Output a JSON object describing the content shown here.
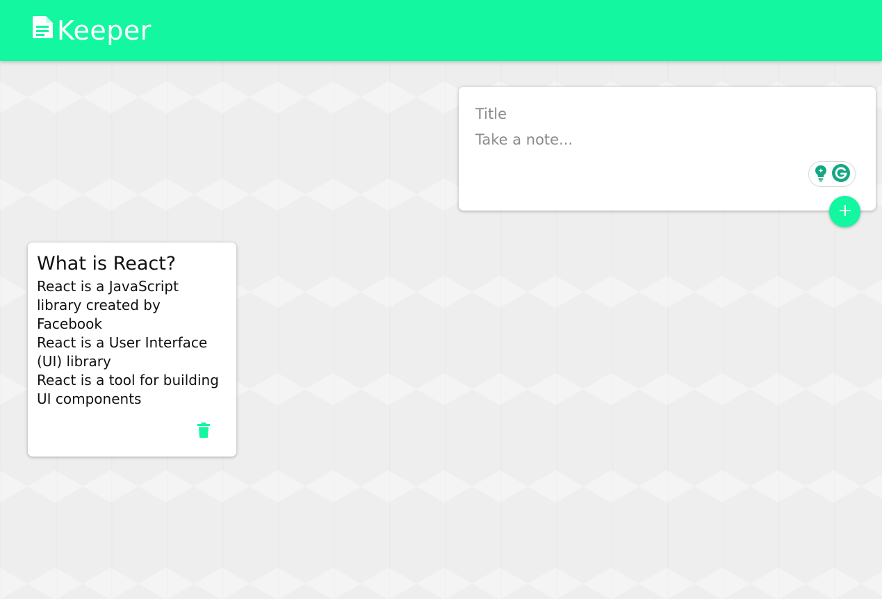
{
  "header": {
    "app_name": "Keeper",
    "logo_icon": "note-document-icon",
    "background_color": "#13f7a0"
  },
  "create_note": {
    "title_placeholder": "Title",
    "content_placeholder": "Take a note...",
    "add_icon": "plus-icon",
    "extension_icons": [
      "lightbulb-icon",
      "grammarly-icon"
    ]
  },
  "notes": [
    {
      "title": "What is React?",
      "content": "React is a JavaScript library created by Facebook\nReact is a User Interface (UI) library\nReact is a tool for building UI components",
      "delete_icon": "trash-icon"
    }
  ],
  "colors": {
    "accent": "#13f7a0",
    "background": "#eeeeee",
    "grammarly": "#15a783"
  }
}
